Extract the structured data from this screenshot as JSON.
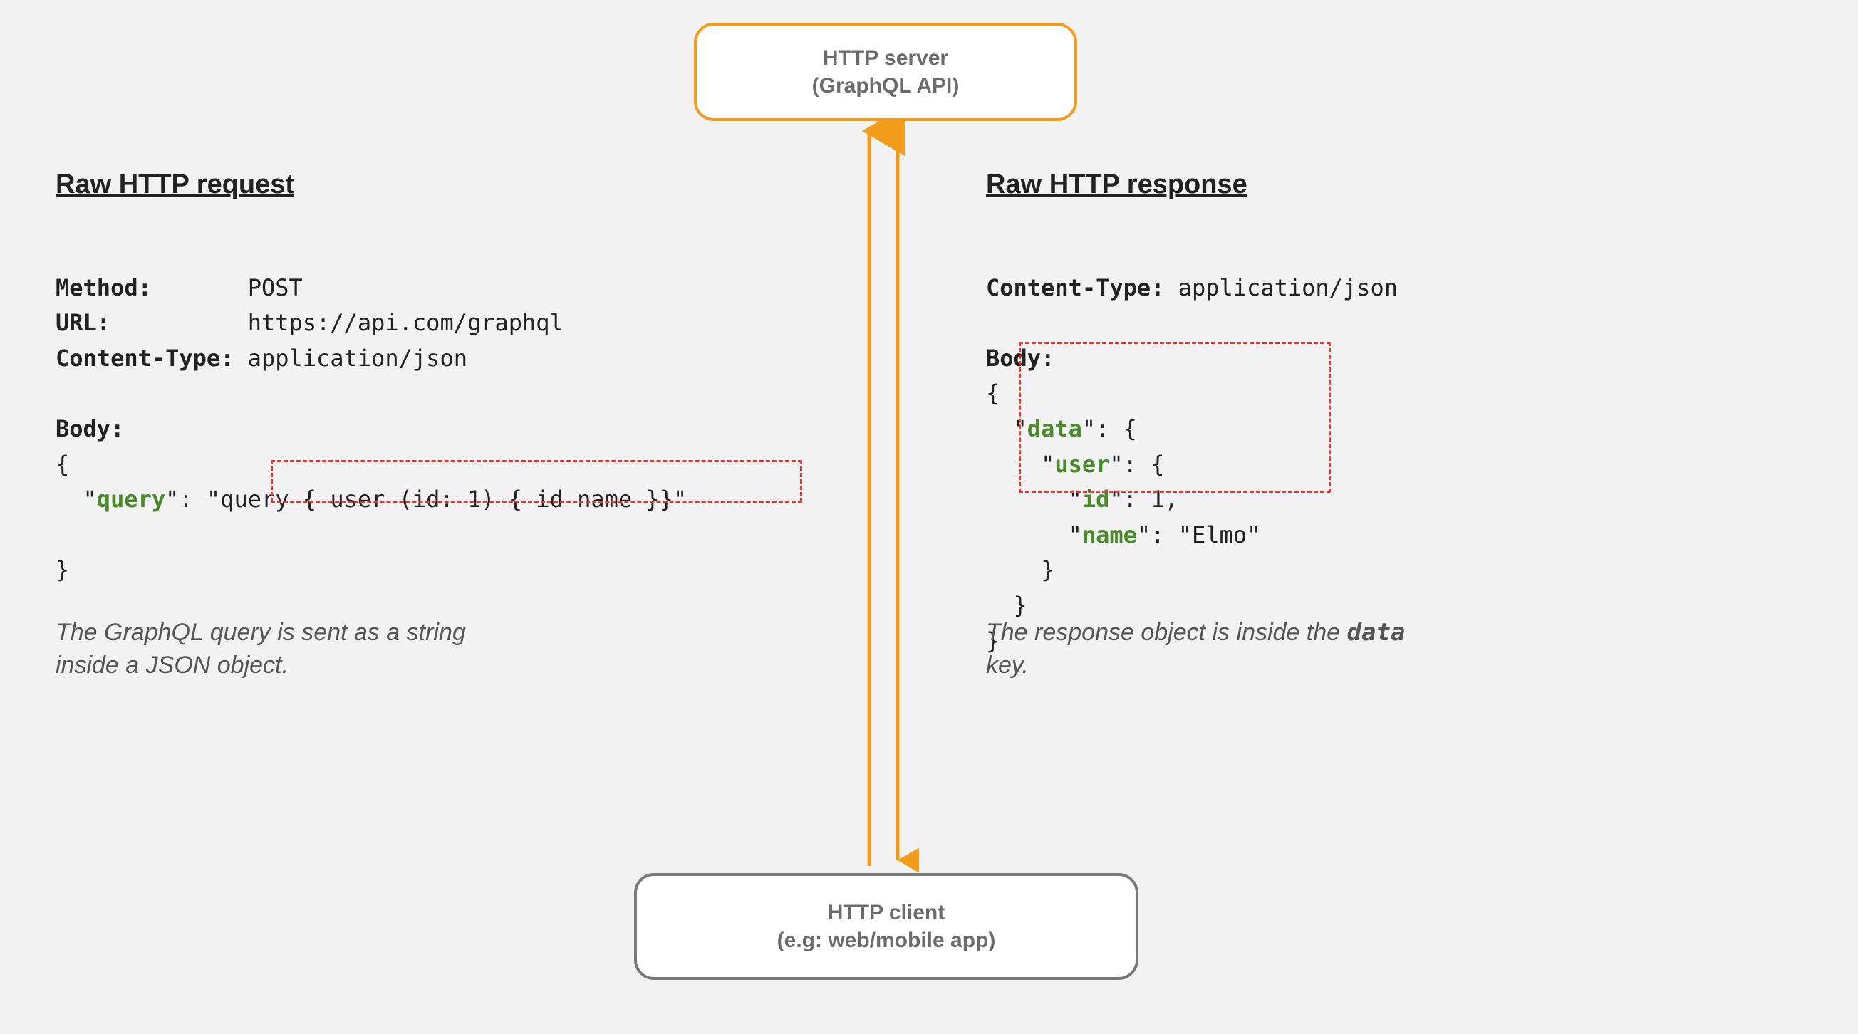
{
  "server": {
    "title": "HTTP server",
    "subtitle": "(GraphQL API)"
  },
  "client": {
    "title": "HTTP client",
    "subtitle": "(e.g: web/mobile app)"
  },
  "request": {
    "title": "Raw HTTP request",
    "method_label": "Method:",
    "method_value": "POST",
    "url_label": "URL:",
    "url_value": "https://api.com/graphql",
    "ctype_label": "Content-Type:",
    "ctype_value": "application/json",
    "body_label": "Body:",
    "brace_open": "{",
    "query_key": "query",
    "query_line_prefix": "  \"",
    "query_sep": "\": ",
    "query_value": "\"query { user (id: 1) { id name }}\"",
    "brace_close": "}",
    "caption_a": "The GraphQL query is sent as a string",
    "caption_b": "inside a JSON object."
  },
  "response": {
    "title": "Raw HTTP response",
    "ctype_label": "Content-Type:",
    "ctype_value": "application/json",
    "body_label": "Body:",
    "brace_open": "{",
    "data_key": "data",
    "data_line_prefix": "  \"",
    "data_sep": "\": {",
    "user_key": "user",
    "user_line_prefix": "    \"",
    "user_sep": "\": {",
    "id_key": "id",
    "id_line_prefix": "      \"",
    "id_sep": "\": ",
    "id_value": "1,",
    "name_key": "name",
    "name_line_prefix": "      \"",
    "name_sep": "\": ",
    "name_value": "\"Elmo\"",
    "inner_close1": "    }",
    "inner_close2": "  }",
    "brace_close": "}",
    "caption_a": "The response object is inside the ",
    "caption_mono": "data",
    "caption_b": "key."
  }
}
